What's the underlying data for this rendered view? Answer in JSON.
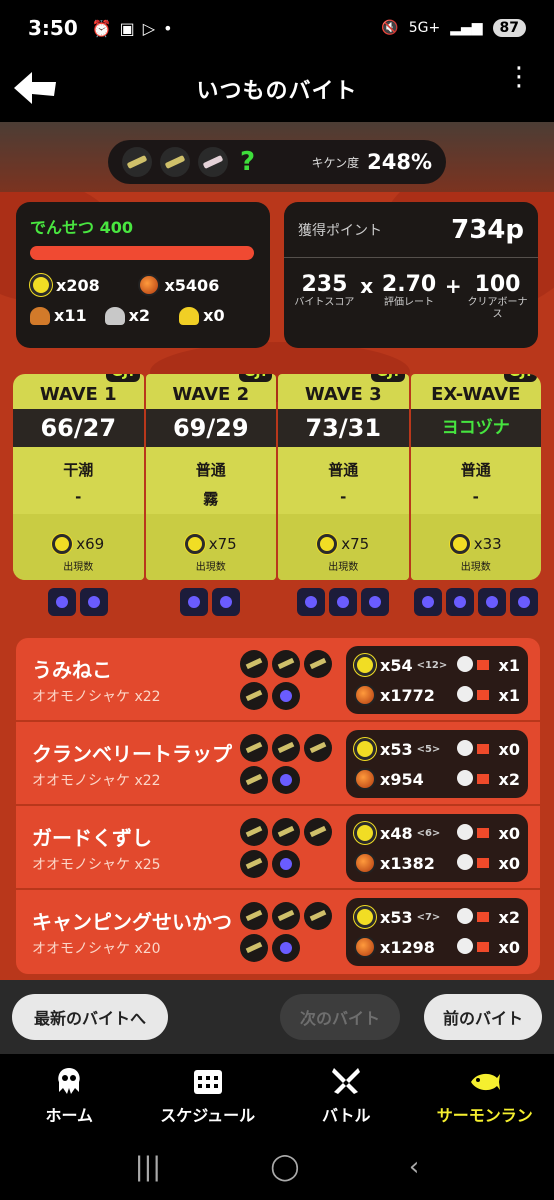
{
  "status": {
    "time": "3:50",
    "network": "5G+",
    "battery": "87"
  },
  "header": {
    "title": "いつものバイト"
  },
  "stage": {
    "kiken_label": "キケン度",
    "kiken_value": "248%",
    "mystery": "?"
  },
  "rank": {
    "name": "でんせつ 400",
    "progress": 1.0,
    "golden_eggs": "x208",
    "power_eggs": "x5406",
    "bronze_scales": "x11",
    "silver_scales": "x2",
    "gold_scales": "x0"
  },
  "points": {
    "label": "獲得ポイント",
    "total": "734p",
    "score": "235",
    "score_label": "バイトスコア",
    "times": "x",
    "rate": "2.70",
    "rate_label": "評価レート",
    "plus": "+",
    "bonus": "100",
    "bonus_label": "クリアボーナス"
  },
  "waves": [
    {
      "name": "WAVE 1",
      "gj": "GJ!",
      "quota": "66/27",
      "tide": "干潮",
      "event": "-",
      "count": "x69",
      "count_label": "出現数"
    },
    {
      "name": "WAVE 2",
      "gj": "GJ!",
      "quota": "69/29",
      "tide": "普通",
      "event": "霧",
      "count": "x75",
      "count_label": "出現数"
    },
    {
      "name": "WAVE 3",
      "gj": "GJ!",
      "quota": "73/31",
      "tide": "普通",
      "event": "-",
      "count": "x75",
      "count_label": "出現数"
    },
    {
      "name": "EX-WAVE",
      "gj": "GJ!",
      "quota": "ヨコヅナ",
      "tide": "普通",
      "event": "-",
      "count": "x33",
      "count_label": "出現数"
    }
  ],
  "players": [
    {
      "name": "うみねこ",
      "boss": "オオモノシャケ x22",
      "golden": "x54",
      "assist": "<12>",
      "power": "x1772",
      "rescue": "x1",
      "rescued": "x1"
    },
    {
      "name": "クランベリートラップ",
      "boss": "オオモノシャケ x22",
      "golden": "x53",
      "assist": "<5>",
      "power": "x954",
      "rescue": "x0",
      "rescued": "x2"
    },
    {
      "name": "ガードくずし",
      "boss": "オオモノシャケ x25",
      "golden": "x48",
      "assist": "<6>",
      "power": "x1382",
      "rescue": "x0",
      "rescued": "x0"
    },
    {
      "name": "キャンピングせいかつ",
      "boss": "オオモノシャケ x20",
      "golden": "x53",
      "assist": "<7>",
      "power": "x1298",
      "rescue": "x2",
      "rescued": "x0"
    }
  ],
  "buttons": {
    "latest": "最新のバイトへ",
    "next": "次のバイト",
    "prev": "前のバイト"
  },
  "tabs": {
    "home": "ホーム",
    "schedule": "スケジュール",
    "battle": "バトル",
    "salmon": "サーモンラン"
  },
  "colors": {
    "accent": "#f5ef2f",
    "panel": "#1c1816",
    "wave": "#d4d74f",
    "player_bg": "#e2492d"
  }
}
